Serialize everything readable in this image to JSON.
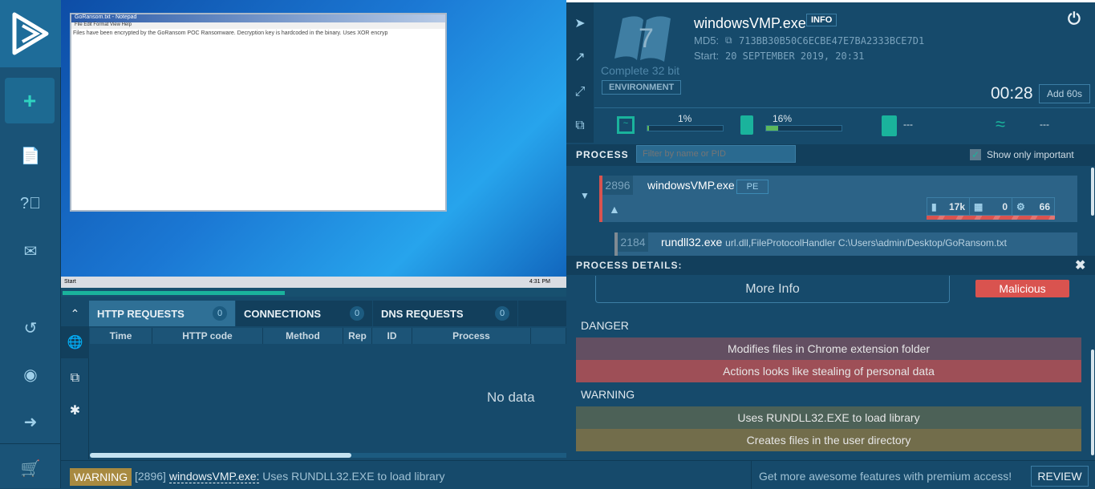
{
  "sidebar": {
    "items": [
      {
        "icon": "logo-icon"
      },
      {
        "icon": "plus-icon",
        "label": "+"
      },
      {
        "icon": "document-icon"
      },
      {
        "icon": "help-icon"
      },
      {
        "icon": "mail-icon"
      },
      {
        "icon": "history-icon"
      },
      {
        "icon": "user-icon"
      },
      {
        "icon": "logout-icon"
      },
      {
        "icon": "cart-icon"
      }
    ]
  },
  "vm": {
    "notepad_title": "GoRansom.txt - Notepad",
    "notepad_menu": "File  Edit  Format  View  Help",
    "notepad_text": "Files have been encrypted by the GoRansom POC Ransomware.  Decryption key is hardcoded in the binary.  Uses XOR encryp",
    "taskbar_start": "Start",
    "taskbar_time": "4:31 PM",
    "progress": 0.44
  },
  "network": {
    "tabs": [
      {
        "label": "HTTP REQUESTS",
        "count": "0"
      },
      {
        "label": "CONNECTIONS",
        "count": "0"
      },
      {
        "label": "DNS REQUESTS",
        "count": "0"
      }
    ],
    "columns": [
      "Time",
      "HTTP code",
      "Method",
      "Rep",
      "ID",
      "Process"
    ],
    "empty": "No data"
  },
  "task": {
    "filename": "windowsVMP.exe",
    "info_label": "INFO",
    "md5_label": "MD5:",
    "md5": "713BB30B50C6ECBE47E7BA2333BCE7D1",
    "start_label": "Start:",
    "start": "20 SEPTEMBER 2019, 20:31",
    "os_version": "7",
    "os_desc": "Complete 32 bit",
    "env_label": "ENVIRONMENT",
    "timer": "00:28",
    "add_label": "Add 60s",
    "cpu": "1%",
    "cpu_value": 0.01,
    "ram": "16%",
    "ram_value": 0.16,
    "disk": "---",
    "net": "---"
  },
  "process": {
    "header": "PROCESS",
    "filter_placeholder": "Filter by name or PID",
    "show_important": "Show only important",
    "items": [
      {
        "pid": "2896",
        "name": "windowsVMP.exe",
        "badge": "PE",
        "files": "17k",
        "reg": "0",
        "mods": "66"
      },
      {
        "pid": "2184",
        "name": "rundll32.exe",
        "args": "url.dll,FileProtocolHandler C:\\Users\\admin/Desktop/GoRansom.txt"
      }
    ]
  },
  "details": {
    "header": "PROCESS DETAILS:",
    "more_info": "More Info",
    "verdict": "Malicious",
    "danger_label": "DANGER",
    "danger": [
      "Modifies files in Chrome extension folder",
      "Actions looks like stealing of personal data"
    ],
    "warning_label": "WARNING",
    "warning": [
      "Uses RUNDLL32.EXE to load library",
      "Creates files in the user directory"
    ]
  },
  "status": {
    "level": "WARNING",
    "pid": "[2896]",
    "proc": "windowsVMP.exe:",
    "msg": "Uses RUNDLL32.EXE to load library",
    "promo": "Get more awesome features with premium access!",
    "review": "REVIEW"
  },
  "colors": {
    "accent": "#1ab39c",
    "malicious": "#d9534f",
    "danger1": "#634f62",
    "danger2": "#9e4f57",
    "warn1": "#4c6157",
    "warn2": "#726d4b"
  }
}
